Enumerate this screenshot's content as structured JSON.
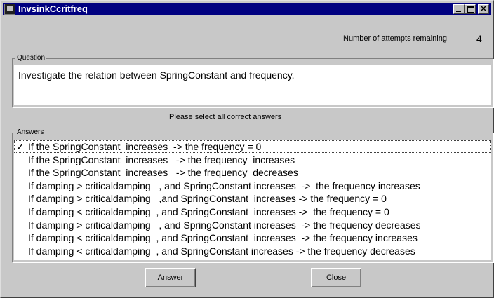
{
  "window": {
    "title": "InvsinkCcritfreq"
  },
  "attempts": {
    "label": "Number of attempts remaining",
    "value": "4"
  },
  "question": {
    "group_label": "Question",
    "text": "Investigate the relation between SpringConstant and frequency."
  },
  "instruction": "Please select all correct answers",
  "answers": {
    "group_label": "Answers",
    "items": [
      {
        "label": "If the SpringConstant  increases  -> the frequency = 0",
        "checked": true
      },
      {
        "label": "If the SpringConstant  increases   -> the frequency  increases",
        "checked": false
      },
      {
        "label": "If the SpringConstant  increases   -> the frequency  decreases",
        "checked": false
      },
      {
        "label": "If damping > criticaldamping   , and SpringConstant increases  ->  the frequency increases",
        "checked": false
      },
      {
        "label": "If damping > criticaldamping   ,and SpringConstant  increases -> the frequency = 0",
        "checked": false
      },
      {
        "label": "If damping < criticaldamping  , and SpringConstant  increases ->  the frequency = 0",
        "checked": false
      },
      {
        "label": "If damping > criticaldamping   , and SpringConstant increases  -> the frequency decreases",
        "checked": false
      },
      {
        "label": "If damping < criticaldamping  , and SpringConstant  increases  -> the frequency increases",
        "checked": false
      },
      {
        "label": "If damping < criticaldamping  , and SpringConstant increases -> the frequency decreases",
        "checked": false
      }
    ]
  },
  "buttons": {
    "answer": "Answer",
    "close": "Close"
  }
}
